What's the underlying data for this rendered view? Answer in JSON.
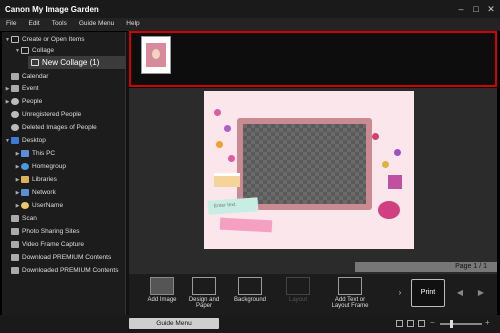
{
  "window": {
    "title": "Canon My Image Garden"
  },
  "menu": [
    "File",
    "Edit",
    "Tools",
    "Guide Menu",
    "Help"
  ],
  "sidebar": {
    "items": [
      {
        "label": "Create or Open Items"
      },
      {
        "label": "Collage"
      },
      {
        "label": "New Collage (1)"
      },
      {
        "label": "Calendar"
      },
      {
        "label": "Event"
      },
      {
        "label": "People"
      },
      {
        "label": "Unregistered People"
      },
      {
        "label": "Deleted Images of People"
      },
      {
        "label": "Desktop"
      },
      {
        "label": "This PC"
      },
      {
        "label": "Homegroup"
      },
      {
        "label": "Libraries"
      },
      {
        "label": "Network"
      },
      {
        "label": "UserName"
      },
      {
        "label": "Scan"
      },
      {
        "label": "Photo Sharing Sites"
      },
      {
        "label": "Video Frame Capture"
      },
      {
        "label": "Download PREMIUM Contents"
      },
      {
        "label": "Downloaded PREMIUM Contents"
      }
    ]
  },
  "canvas": {
    "text_tag": "Enter text.",
    "page_indicator": "Page 1 / 1"
  },
  "toolbar": {
    "add_image": "Add Image",
    "design_paper_line1": "Design and",
    "design_paper_line2": "Paper",
    "background": "Background",
    "layout": "Layout",
    "add_text_line1": "Add Text or",
    "add_text_line2": "Layout Frame",
    "print": "Print"
  },
  "status": {
    "guide_menu": "Guide Menu"
  },
  "colors": {
    "selection_outline": "#d40000",
    "paper": "#fbe6ec",
    "frame": "#c98a92"
  }
}
